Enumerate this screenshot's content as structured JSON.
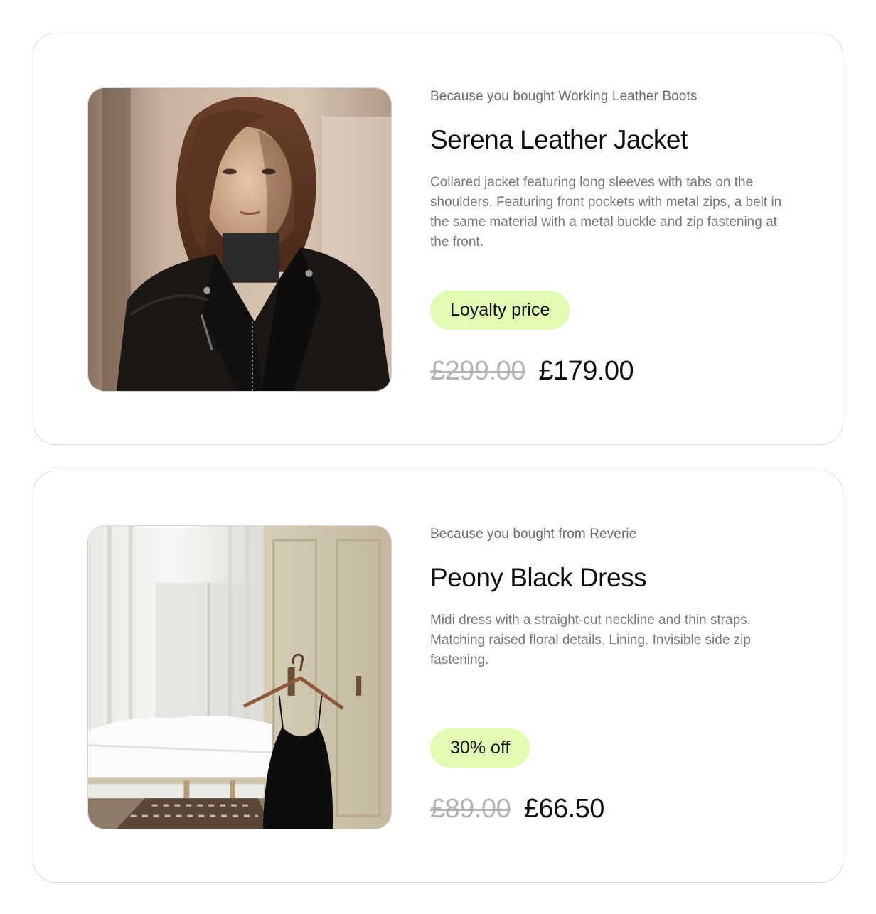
{
  "products": [
    {
      "reason": "Because you bought Working Leather Boots",
      "title": "Serena Leather Jacket",
      "description": "Collared jacket featuring long sleeves with tabs on the shoulders. Featuring front pockets with metal zips, a belt in the same material with a metal buckle and zip fastening at the front.",
      "badge": "Loyalty price",
      "old_price": "£299.00",
      "new_price": "£179.00",
      "image": "woman-in-leather-jacket-photo"
    },
    {
      "reason": "Because you bought from Reverie",
      "title": "Peony Black Dress",
      "description": "Midi dress with a straight-cut neckline and thin straps. Matching raised floral details. Lining. Invisible side zip fastening.",
      "badge": "30% off",
      "old_price": "£89.00",
      "new_price": "£66.50",
      "image": "black-dress-on-hanger-photo"
    }
  ],
  "colors": {
    "badge_bg": "#e2fbb4",
    "old_price": "#b4b4b4",
    "card_border": "#dcdcdc"
  }
}
